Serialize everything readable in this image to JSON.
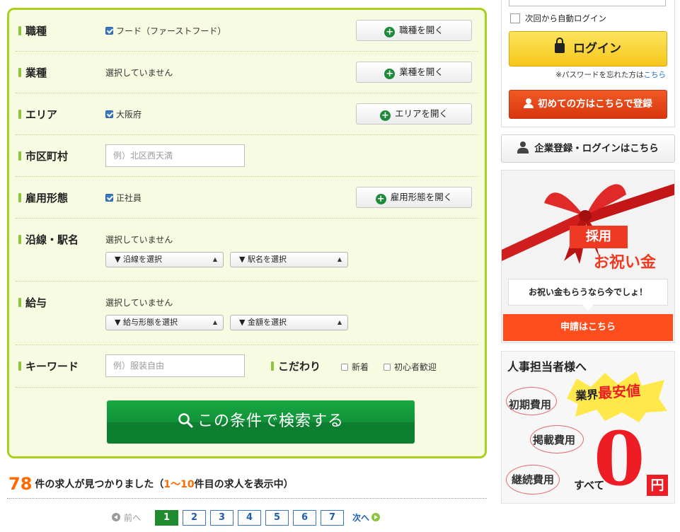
{
  "search": {
    "rows": {
      "occupation": {
        "label": "職種",
        "value": "フード（ファーストフード）",
        "button": "職種を開く"
      },
      "industry": {
        "label": "業種",
        "value": "選択していません",
        "button": "業種を開く"
      },
      "area": {
        "label": "エリア",
        "value": "大阪府",
        "button": "エリアを開く"
      },
      "city": {
        "label": "市区町村",
        "placeholder": "例）北区西天満"
      },
      "employment": {
        "label": "雇用形態",
        "value": "正社員",
        "button": "雇用形態を開く"
      },
      "line_station": {
        "label": "沿線・駅名",
        "value": "選択していません",
        "line_select": "▼ 沿線を選択",
        "station_select": "▼ 駅名を選択"
      },
      "salary": {
        "label": "給与",
        "value": "選択していません",
        "type_select": "▼ 給与形態を選択",
        "amount_select": "▼ 金額を選択"
      },
      "keyword": {
        "label": "キーワード",
        "placeholder": "例）服装自由"
      },
      "preference": {
        "label": "こだわり",
        "options": [
          "新着",
          "初心者歓迎"
        ]
      }
    },
    "submit_label": "この条件で検索する"
  },
  "results": {
    "count": "78",
    "text_found": "件の求人が見つかりました",
    "open_paren": "（",
    "range": "1〜10",
    "text_showing": "件目の求人を表示中）"
  },
  "pager": {
    "prev": "前へ",
    "pages": [
      "1",
      "2",
      "3",
      "4",
      "5",
      "6",
      "7"
    ],
    "current_page": "1",
    "next": "次へ"
  },
  "sidebar": {
    "auto_login": "次回から自動ログイン",
    "login_button": "ログイン",
    "forgot_text": "※パスワードを忘れた方は",
    "forgot_link": "こちら",
    "register_button": "初めての方はこちらで登録",
    "corporate_button": "企業登録・ログインはこちら",
    "gift_banner": {
      "badge": "採用",
      "title": "お祝い金",
      "bubble": "お祝い金もらうなら今でしょ！",
      "apply": "申請はこちら"
    },
    "hr_banner": {
      "title": "人事担当者様へ",
      "lowest_prefix": "業界",
      "lowest_emph": "最安値",
      "fees": [
        "初期費用",
        "掲載費用",
        "継続費用"
      ],
      "all": "すべて",
      "zero": "0",
      "yen": "円"
    }
  },
  "colors": {
    "panel_border": "#a9d11c",
    "panel_bg": "#f7fbe1",
    "search_button": "#12923a",
    "accent_orange": "#ff6a00",
    "link_blue": "#1f6fc9",
    "login_yellow": "#f5c61b",
    "register_red": "#d9350f"
  }
}
